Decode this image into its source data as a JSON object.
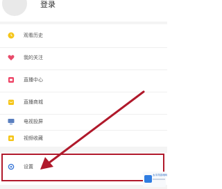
{
  "header": {
    "login_label": "登录"
  },
  "menu": {
    "items": [
      {
        "label": "观看历史",
        "icon": "history-icon",
        "color": "#f5c518"
      },
      {
        "label": "我的关注",
        "icon": "heart-icon",
        "color": "#e84a6a"
      },
      {
        "label": "直播中心",
        "icon": "live-center-icon",
        "color": "#ee4466"
      },
      {
        "label": "直播商城",
        "icon": "mall-icon",
        "color": "#f5c518"
      },
      {
        "label": "电视投屏",
        "icon": "tv-cast-icon",
        "color": "#5a7fbf"
      },
      {
        "label": "视频收藏",
        "icon": "favorite-icon",
        "color": "#f5c518"
      },
      {
        "label": "设置",
        "icon": "settings-gear-icon",
        "color": "#3c78d8"
      }
    ]
  },
  "annotation": {
    "highlight_color": "#b0192b",
    "arrow_color": "#b0192b"
  },
  "watermark": {
    "text": "太平洋游戏网"
  }
}
